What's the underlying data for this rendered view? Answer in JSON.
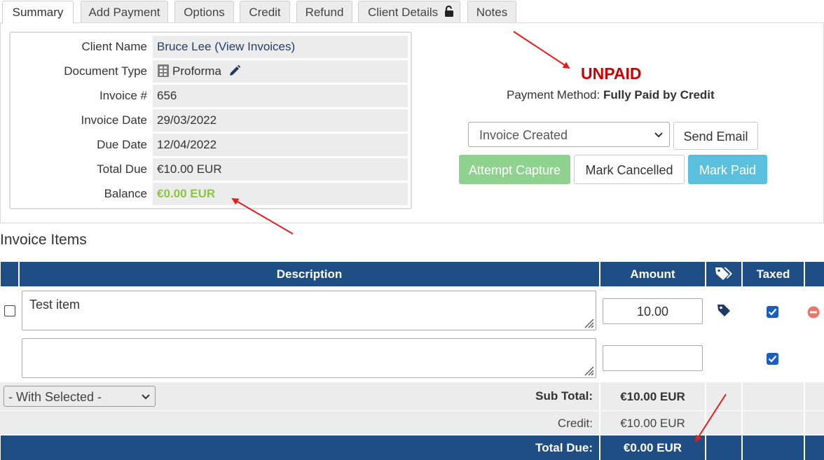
{
  "tabs": [
    {
      "label": "Summary"
    },
    {
      "label": "Add Payment"
    },
    {
      "label": "Options"
    },
    {
      "label": "Credit"
    },
    {
      "label": "Refund"
    },
    {
      "label": "Client Details"
    },
    {
      "label": "Notes"
    }
  ],
  "summary": {
    "labels": {
      "client_name": "Client Name",
      "document_type": "Document Type",
      "invoice_no": "Invoice #",
      "invoice_date": "Invoice Date",
      "due_date": "Due Date",
      "total_due": "Total Due",
      "balance": "Balance"
    },
    "values": {
      "client_name": "Bruce Lee (View Invoices)",
      "document_type": "Proforma",
      "invoice_no": "656",
      "invoice_date": "29/03/2022",
      "due_date": "12/04/2022",
      "total_due": "€10.00 EUR",
      "balance": "€0.00 EUR"
    }
  },
  "status": {
    "text": "UNPAID",
    "color": "#cc0000",
    "payment_method_label": "Payment Method:",
    "payment_method_value": "Fully Paid by Credit"
  },
  "actions": {
    "status_select": "Invoice Created",
    "send_email": "Send Email",
    "attempt_capture": "Attempt Capture",
    "mark_cancelled": "Mark Cancelled",
    "mark_paid": "Mark Paid"
  },
  "items": {
    "section_title": "Invoice Items",
    "headers": {
      "description": "Description",
      "amount": "Amount",
      "taxed": "Taxed"
    },
    "rows": [
      {
        "description": "Test item",
        "amount": "10.00",
        "taxed": true
      },
      {
        "description": "",
        "amount": "",
        "taxed": true
      }
    ],
    "with_selected": "- With Selected -",
    "subtotal_label": "Sub Total:",
    "subtotal_value": "€10.00 EUR",
    "credit_label": "Credit:",
    "credit_value": "€10.00 EUR",
    "total_due_label": "Total Due:",
    "total_due_value": "€0.00 EUR"
  },
  "colors": {
    "header_blue": "#1e4e84",
    "balance_green": "#8cc63f",
    "capture_green": "#8fd18f",
    "mark_paid_blue": "#5bc0de",
    "annotation_red": "#e02020"
  }
}
